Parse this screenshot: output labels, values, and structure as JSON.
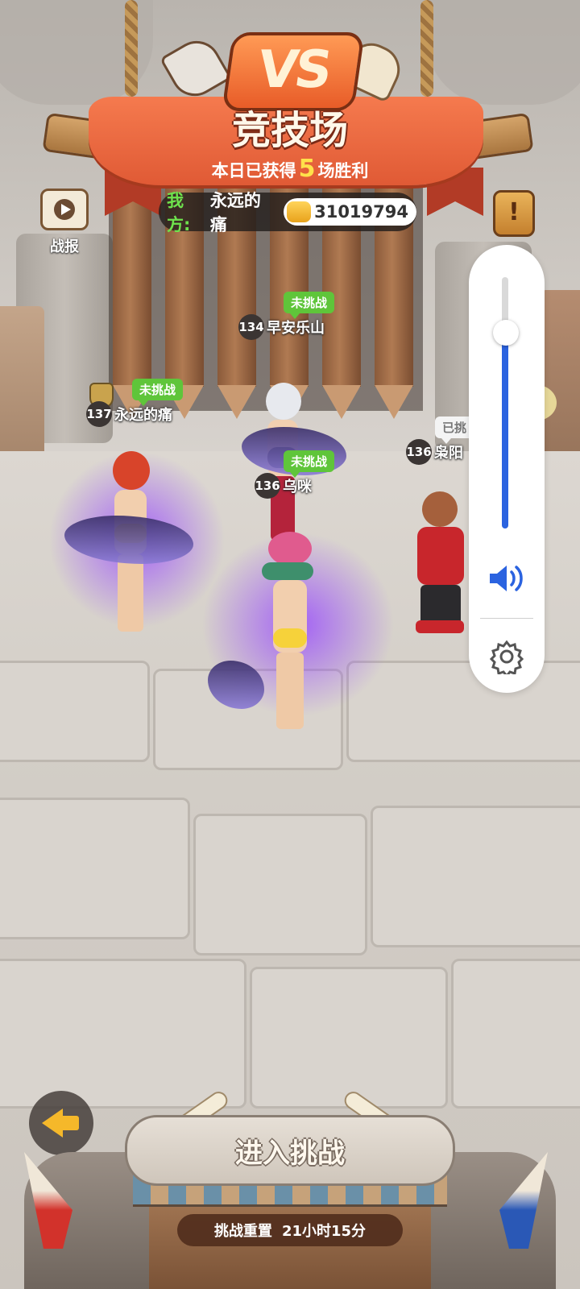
{
  "header": {
    "vs_emblem": "VS",
    "title": "竞技场",
    "daily_wins_prefix": "本日已获得",
    "daily_wins_count": "5",
    "daily_wins_suffix": "场胜利",
    "my_side_label": "我方:",
    "my_name": "永远的痛",
    "my_power": "31019794"
  },
  "left_buttons": {
    "report_icon": "play-video-icon",
    "report_label": "战报"
  },
  "right_buttons": {
    "alert_icon": "exclamation-icon",
    "alert_text": "!"
  },
  "opponents": [
    {
      "status": "未挑战",
      "level": "134",
      "name": "早安乐山"
    },
    {
      "status": "未挑战",
      "level": "137",
      "name": "永远的痛"
    },
    {
      "status": "未挑战",
      "level": "136",
      "name": "乌咪"
    },
    {
      "status": "已挑",
      "level": "136",
      "name": "枭阳"
    }
  ],
  "volume_panel": {
    "level_fraction": 0.78,
    "speaker_icon": "speaker-volume-icon",
    "settings_icon": "gear-icon",
    "accent": "#2b63e0"
  },
  "bottom": {
    "back_icon": "back-arrow-icon",
    "enter_label": "进入挑战",
    "reset_label": "挑战重置",
    "reset_time": "21小时15分"
  },
  "colors": {
    "not_challenged_tag": "#5fc53a",
    "win_count": "#ffe14a",
    "banner": "#e05a35"
  }
}
